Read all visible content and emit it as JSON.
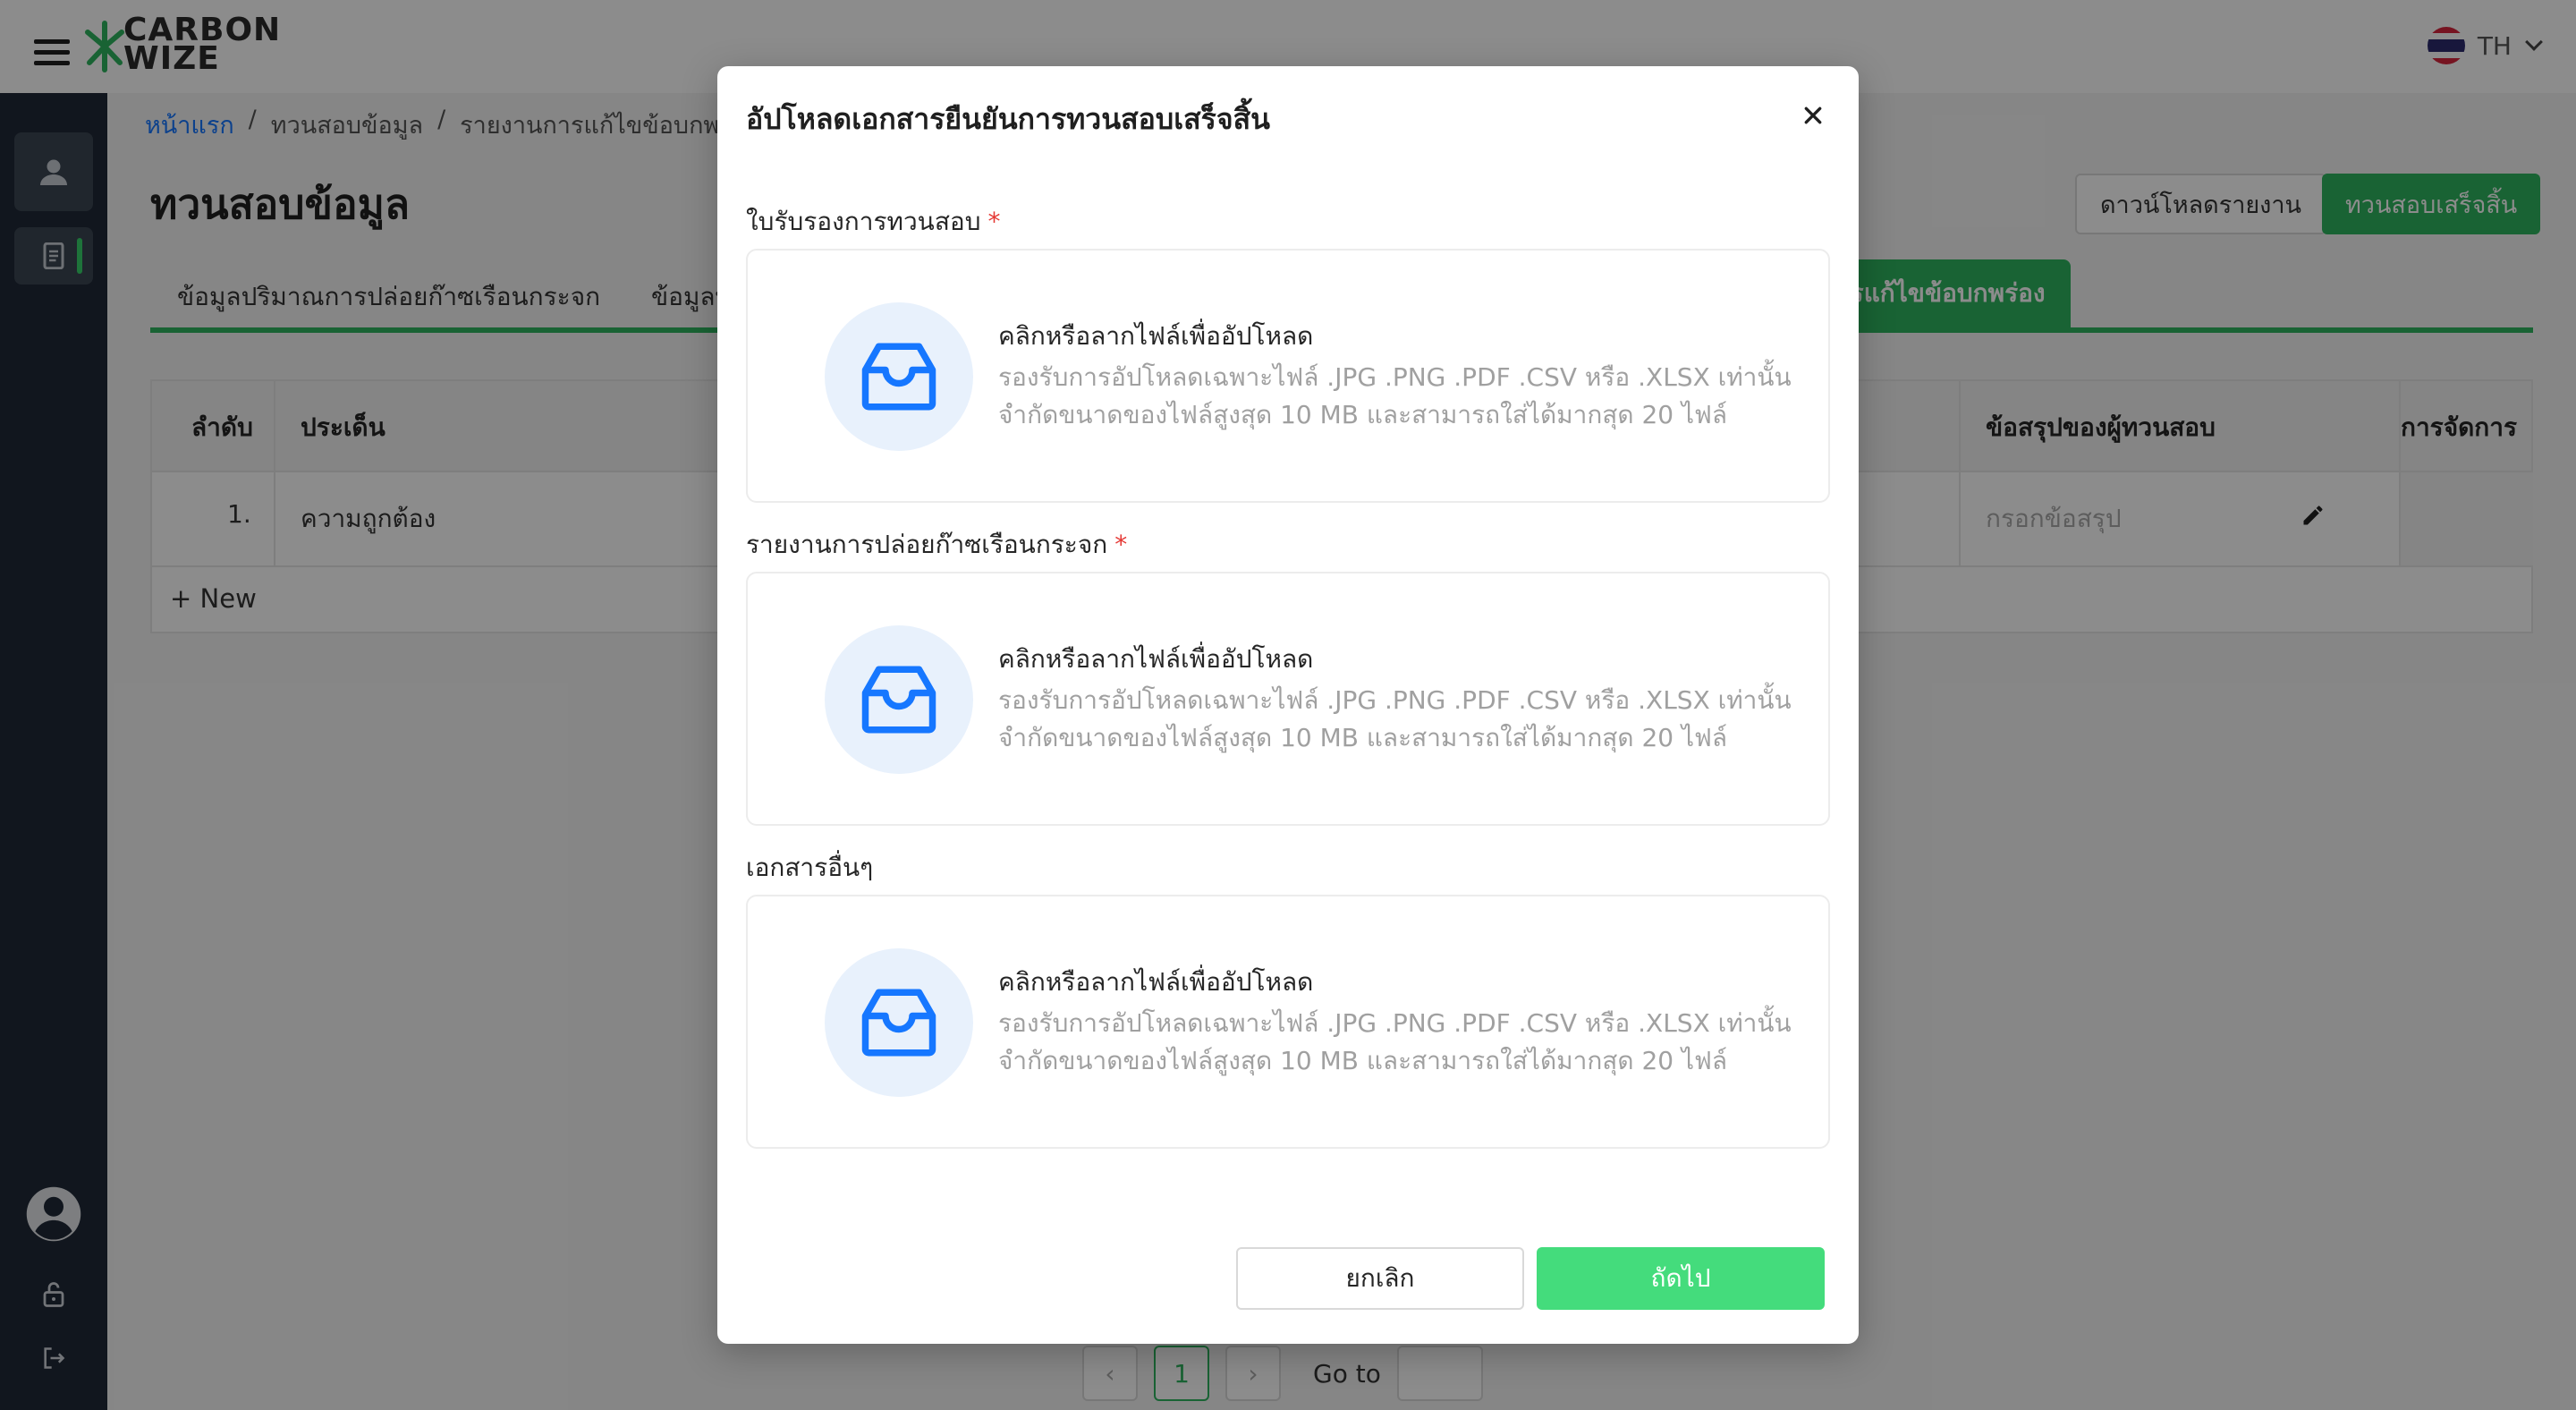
{
  "header": {
    "logo_line1": "CARBON",
    "logo_line2": "WIZE",
    "lang_code": "TH"
  },
  "breadcrumb": {
    "home": "หน้าแรก",
    "sep": "/",
    "level2": "ทวนสอบข้อมูล",
    "level3": "รายงานการแก้ไขข้อบกพร่อ"
  },
  "page": {
    "title": "ทวนสอบข้อมูล",
    "download_label": "ดาวน์โหลดรายงาน",
    "complete_label": "ทวนสอบเสร็จสิ้น"
  },
  "tabs": [
    {
      "label": "ข้อมูลปริมาณการปล่อยก๊าซเรือนกระจก"
    },
    {
      "label": "ข้อมูลทั่วไป"
    },
    {
      "label": "การแก้ไขข้อบกพร่อง"
    }
  ],
  "table": {
    "columns": [
      "ลำดับ",
      "ประเด็น",
      "ข้อสรุปของผู้ทวนสอบ",
      "การจัดการ"
    ],
    "rows": [
      {
        "no": "1.",
        "issue": "ความถูกต้อง",
        "conclusion_placeholder": "กรอกข้อสรุป"
      }
    ],
    "new_label": "New"
  },
  "pagination": {
    "current": "1",
    "goto_label": "Go to"
  },
  "modal": {
    "title": "อัปโหลดเอกสารยืนยันการทวนสอบเสร็จสิ้น",
    "fields": [
      {
        "label": "ใบรับรองการทวนสอบ",
        "required": "*"
      },
      {
        "label": "รายงานการปล่อยก๊าซเรือนกระจก",
        "required": "*"
      },
      {
        "label": "เอกสารอื่นๆ",
        "required": ""
      }
    ],
    "upload_title": "คลิกหรือลากไฟล์เพื่ออัปโหลด",
    "upload_hint_1": "รองรับการอัปโหลดเฉพาะไฟล์ .JPG .PNG .PDF .CSV หรือ .XLSX เท่านั้น",
    "upload_hint_2": "จำกัดขนาดของไฟล์สูงสุด 10 MB และสามารถใส่ได้มากสุด 20 ไฟล์",
    "cancel_label": "ยกเลิก",
    "next_label": "ถัดไป"
  },
  "colors": {
    "brand_green": "#2fb45f",
    "next_button": "#44dc7c",
    "sidebar": "#1f2937",
    "upload_icon": "#1677ff",
    "required_mark": "#e53935"
  }
}
